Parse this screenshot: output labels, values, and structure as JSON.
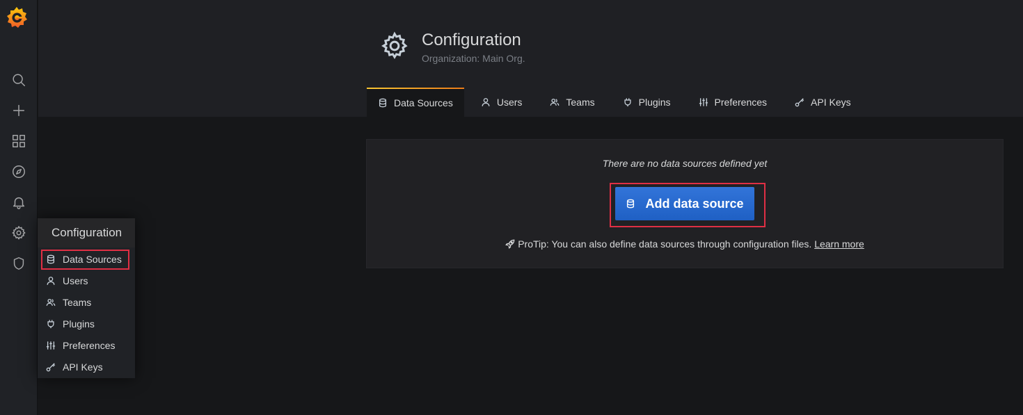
{
  "sidebar": {
    "logo": "grafana-logo",
    "icons": [
      "search-icon",
      "plus-icon",
      "dashboards-icon",
      "explore-icon",
      "alerting-icon",
      "configuration-icon",
      "shield-icon"
    ]
  },
  "header": {
    "title": "Configuration",
    "subtitle": "Organization: Main Org."
  },
  "tabs": [
    {
      "label": "Data Sources",
      "icon": "database-icon",
      "active": true
    },
    {
      "label": "Users",
      "icon": "user-icon",
      "active": false
    },
    {
      "label": "Teams",
      "icon": "users-icon",
      "active": false
    },
    {
      "label": "Plugins",
      "icon": "plug-icon",
      "active": false
    },
    {
      "label": "Preferences",
      "icon": "sliders-icon",
      "active": false
    },
    {
      "label": "API Keys",
      "icon": "key-icon",
      "active": false
    }
  ],
  "empty_state": {
    "message": "There are no data sources defined yet",
    "button_label": "Add data source",
    "protip_text": "ProTip: You can also define data sources through configuration files. ",
    "learn_more": "Learn more"
  },
  "dropdown": {
    "title": "Configuration",
    "items": [
      {
        "label": "Data Sources",
        "icon": "database-icon"
      },
      {
        "label": "Users",
        "icon": "user-icon"
      },
      {
        "label": "Teams",
        "icon": "users-icon"
      },
      {
        "label": "Plugins",
        "icon": "plug-icon"
      },
      {
        "label": "Preferences",
        "icon": "sliders-icon"
      },
      {
        "label": "API Keys",
        "icon": "key-icon"
      }
    ]
  },
  "colors": {
    "background": "#161719",
    "panel": "#212124",
    "primary_button": "#3274d9",
    "highlight_outline": "#e02f44",
    "active_tab_gradient": [
      "#f9c633",
      "#eb7b18"
    ]
  }
}
